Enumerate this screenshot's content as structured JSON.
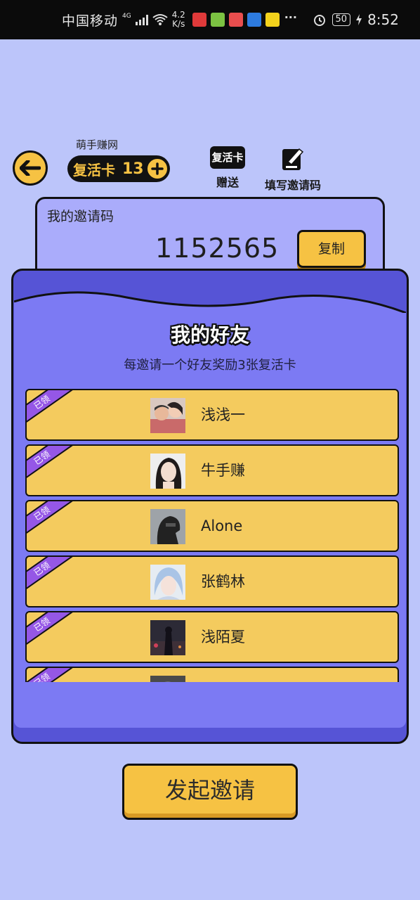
{
  "status_bar": {
    "carrier": "中国移动",
    "network": "4G",
    "speed_value": "4.2",
    "speed_unit": "K/s",
    "battery": "50",
    "time": "8:52"
  },
  "header": {
    "brand": "萌手赚网",
    "revive_card_label": "复活卡",
    "revive_card_count": "13",
    "gift_badge": "复活卡",
    "gift_label": "赠送",
    "fill_invite_label": "填写邀请码"
  },
  "invite_code": {
    "label": "我的邀请码",
    "value": "1152565",
    "copy_label": "复制"
  },
  "friends": {
    "title": "我的好友",
    "subtitle": "每邀请一个好友奖励3张复活卡",
    "claimed_label": "已领",
    "items": [
      {
        "name": "浅浅一",
        "avatar": "avatar-couple-photo"
      },
      {
        "name": "牛手赚",
        "avatar": "avatar-woman-photo"
      },
      {
        "name": "Alone",
        "avatar": "avatar-dark-silhouette"
      },
      {
        "name": "张鹤林",
        "avatar": "avatar-anime-portrait"
      },
      {
        "name": "浅陌夏",
        "avatar": "avatar-night-scene"
      },
      {
        "name": "",
        "avatar": "avatar-partial"
      }
    ]
  },
  "invite_button": {
    "label": "发起邀请"
  },
  "colors": {
    "background": "#bcc5fa",
    "accent_yellow": "#f6c243",
    "panel_purple": "#5654d6",
    "panel_inner": "#7c7af3",
    "code_card": "#aaacfb",
    "ribbon_purple": "#9557e6"
  }
}
